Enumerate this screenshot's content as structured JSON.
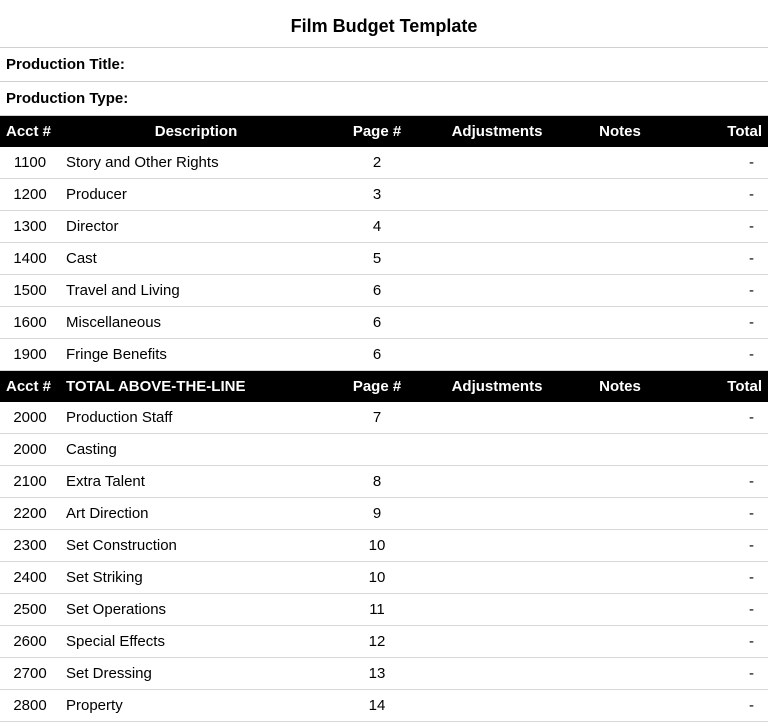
{
  "title": "Film Budget Template",
  "labels": {
    "production_title": "Production Title:",
    "production_type": "Production Type:"
  },
  "header1": {
    "acct": "Acct #",
    "desc": "Description",
    "page": "Page #",
    "adj": "Adjustments",
    "notes": "Notes",
    "total": "Total"
  },
  "section1_rows": [
    {
      "acct": "1100",
      "desc": "Story and Other Rights",
      "page": "2",
      "adj": "",
      "notes": "",
      "total": "-"
    },
    {
      "acct": "1200",
      "desc": "Producer",
      "page": "3",
      "adj": "",
      "notes": "",
      "total": "-"
    },
    {
      "acct": "1300",
      "desc": "Director",
      "page": "4",
      "adj": "",
      "notes": "",
      "total": "-"
    },
    {
      "acct": "1400",
      "desc": "Cast",
      "page": "5",
      "adj": "",
      "notes": "",
      "total": "-"
    },
    {
      "acct": "1500",
      "desc": "Travel and Living",
      "page": "6",
      "adj": "",
      "notes": "",
      "total": "-"
    },
    {
      "acct": "1600",
      "desc": "Miscellaneous",
      "page": "6",
      "adj": "",
      "notes": "",
      "total": "-"
    },
    {
      "acct": "1900",
      "desc": "Fringe Benefits",
      "page": "6",
      "adj": "",
      "notes": "",
      "total": "-"
    }
  ],
  "header2": {
    "acct": "Acct #",
    "desc": "TOTAL ABOVE-THE-LINE",
    "page": "Page #",
    "adj": "Adjustments",
    "notes": "Notes",
    "total": "Total"
  },
  "section2_rows": [
    {
      "acct": "2000",
      "desc": "Production Staff",
      "page": "7",
      "adj": "",
      "notes": "",
      "total": "-"
    },
    {
      "acct": "2000",
      "desc": "Casting",
      "page": "",
      "adj": "",
      "notes": "",
      "total": ""
    },
    {
      "acct": "2100",
      "desc": "Extra Talent",
      "page": "8",
      "adj": "",
      "notes": "",
      "total": "-"
    },
    {
      "acct": "2200",
      "desc": "Art Direction",
      "page": "9",
      "adj": "",
      "notes": "",
      "total": "-"
    },
    {
      "acct": "2300",
      "desc": "Set Construction",
      "page": "10",
      "adj": "",
      "notes": "",
      "total": "-"
    },
    {
      "acct": "2400",
      "desc": "Set Striking",
      "page": "10",
      "adj": "",
      "notes": "",
      "total": "-"
    },
    {
      "acct": "2500",
      "desc": "Set Operations",
      "page": "11",
      "adj": "",
      "notes": "",
      "total": "-"
    },
    {
      "acct": "2600",
      "desc": "Special Effects",
      "page": "12",
      "adj": "",
      "notes": "",
      "total": "-"
    },
    {
      "acct": "2700",
      "desc": "Set Dressing",
      "page": "13",
      "adj": "",
      "notes": "",
      "total": "-"
    },
    {
      "acct": "2800",
      "desc": "Property",
      "page": "14",
      "adj": "",
      "notes": "",
      "total": "-"
    }
  ]
}
